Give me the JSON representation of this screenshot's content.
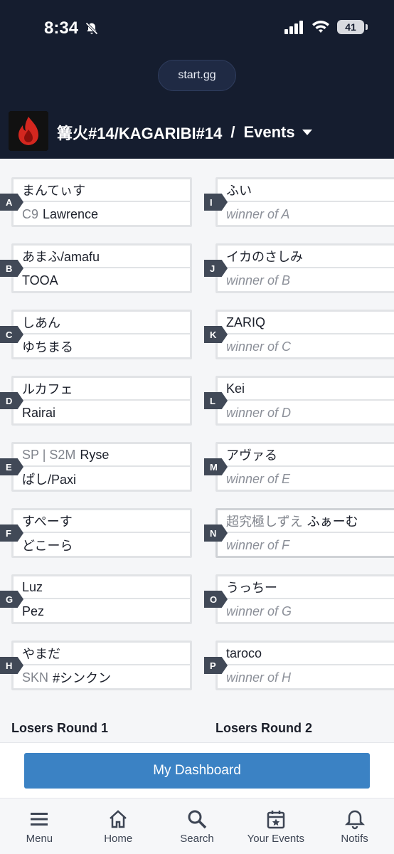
{
  "status": {
    "time": "8:34",
    "battery": "41"
  },
  "browser": {
    "url": "start.gg"
  },
  "header": {
    "title": "篝火#14/KAGARIBI#14",
    "separator": "/",
    "section": "Events"
  },
  "bracket": {
    "round1": [
      {
        "id": "A",
        "p1": {
          "prefix": "",
          "name": "まんてぃす"
        },
        "p2": {
          "prefix": "C9",
          "name": "Lawrence"
        }
      },
      {
        "id": "B",
        "p1": {
          "prefix": "",
          "name": "あまふ/amafu"
        },
        "p2": {
          "prefix": "",
          "name": "TOOA"
        }
      },
      {
        "id": "C",
        "p1": {
          "prefix": "",
          "name": "しあん"
        },
        "p2": {
          "prefix": "",
          "name": "ゆちまる"
        }
      },
      {
        "id": "D",
        "p1": {
          "prefix": "",
          "name": "ルカフェ"
        },
        "p2": {
          "prefix": "",
          "name": "Rairai"
        }
      },
      {
        "id": "E",
        "p1": {
          "prefix": "SP | S2M",
          "name": "Ryse"
        },
        "p2": {
          "prefix": "",
          "name": "ぱし/Paxi"
        }
      },
      {
        "id": "F",
        "p1": {
          "prefix": "",
          "name": "すぺーす"
        },
        "p2": {
          "prefix": "",
          "name": "どこーら"
        }
      },
      {
        "id": "G",
        "p1": {
          "prefix": "",
          "name": "Luz"
        },
        "p2": {
          "prefix": "",
          "name": "Pez"
        }
      },
      {
        "id": "H",
        "p1": {
          "prefix": "",
          "name": "やまだ"
        },
        "p2": {
          "prefix": "SKN",
          "name": "#シンクン"
        }
      }
    ],
    "round2": [
      {
        "id": "I",
        "p1": {
          "prefix": "",
          "name": "ふい"
        },
        "p2": "winner of A"
      },
      {
        "id": "J",
        "p1": {
          "prefix": "",
          "name": "イカのさしみ"
        },
        "p2": "winner of B"
      },
      {
        "id": "K",
        "p1": {
          "prefix": "",
          "name": "ZARIQ"
        },
        "p2": "winner of C"
      },
      {
        "id": "L",
        "p1": {
          "prefix": "",
          "name": "Kei"
        },
        "p2": "winner of D"
      },
      {
        "id": "M",
        "p1": {
          "prefix": "",
          "name": "アヴァる"
        },
        "p2": "winner of E"
      },
      {
        "id": "N",
        "p1": {
          "prefix": "超究極しずえ",
          "name": "ふぁーむ"
        },
        "p2": "winner of F"
      },
      {
        "id": "O",
        "p1": {
          "prefix": "",
          "name": "うっちー"
        },
        "p2": "winner of G"
      },
      {
        "id": "P",
        "p1": {
          "prefix": "",
          "name": "taroco"
        },
        "p2": "winner of H"
      }
    ],
    "round_labels": [
      "Losers Round 1",
      "Losers Round 2"
    ]
  },
  "dashboard_button": "My Dashboard",
  "nav": [
    {
      "label": "Menu",
      "icon": "menu-icon"
    },
    {
      "label": "Home",
      "icon": "home-icon"
    },
    {
      "label": "Search",
      "icon": "search-icon"
    },
    {
      "label": "Your Events",
      "icon": "calendar-star-icon"
    },
    {
      "label": "Notifs",
      "icon": "bell-icon"
    }
  ]
}
